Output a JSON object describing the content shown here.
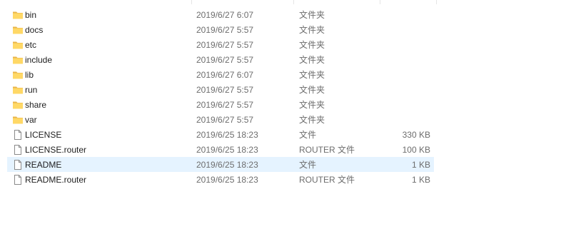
{
  "files": [
    {
      "name": "bin",
      "date": "2019/6/27 6:07",
      "type": "文件夹",
      "size": "",
      "kind": "folder",
      "icon": "folder-icon"
    },
    {
      "name": "docs",
      "date": "2019/6/27 5:57",
      "type": "文件夹",
      "size": "",
      "kind": "folder",
      "icon": "folder-icon"
    },
    {
      "name": "etc",
      "date": "2019/6/27 5:57",
      "type": "文件夹",
      "size": "",
      "kind": "folder",
      "icon": "folder-icon"
    },
    {
      "name": "include",
      "date": "2019/6/27 5:57",
      "type": "文件夹",
      "size": "",
      "kind": "folder",
      "icon": "folder-icon"
    },
    {
      "name": "lib",
      "date": "2019/6/27 6:07",
      "type": "文件夹",
      "size": "",
      "kind": "folder",
      "icon": "folder-icon"
    },
    {
      "name": "run",
      "date": "2019/6/27 5:57",
      "type": "文件夹",
      "size": "",
      "kind": "folder",
      "icon": "folder-icon"
    },
    {
      "name": "share",
      "date": "2019/6/27 5:57",
      "type": "文件夹",
      "size": "",
      "kind": "folder",
      "icon": "folder-icon"
    },
    {
      "name": "var",
      "date": "2019/6/27 5:57",
      "type": "文件夹",
      "size": "",
      "kind": "folder",
      "icon": "folder-icon"
    },
    {
      "name": "LICENSE",
      "date": "2019/6/25 18:23",
      "type": "文件",
      "size": "330 KB",
      "kind": "file",
      "icon": "file-icon"
    },
    {
      "name": "LICENSE.router",
      "date": "2019/6/25 18:23",
      "type": "ROUTER 文件",
      "size": "100 KB",
      "kind": "file",
      "icon": "file-icon"
    },
    {
      "name": "README",
      "date": "2019/6/25 18:23",
      "type": "文件",
      "size": "1 KB",
      "kind": "file",
      "icon": "file-icon",
      "selected": true
    },
    {
      "name": "README.router",
      "date": "2019/6/25 18:23",
      "type": "ROUTER 文件",
      "size": "1 KB",
      "kind": "file",
      "icon": "file-icon"
    }
  ],
  "colors": {
    "folder_fill": "#ffd866",
    "folder_tab": "#e8b54a",
    "selection": "#e5f3ff",
    "secondary_text": "#6d6d6d"
  }
}
